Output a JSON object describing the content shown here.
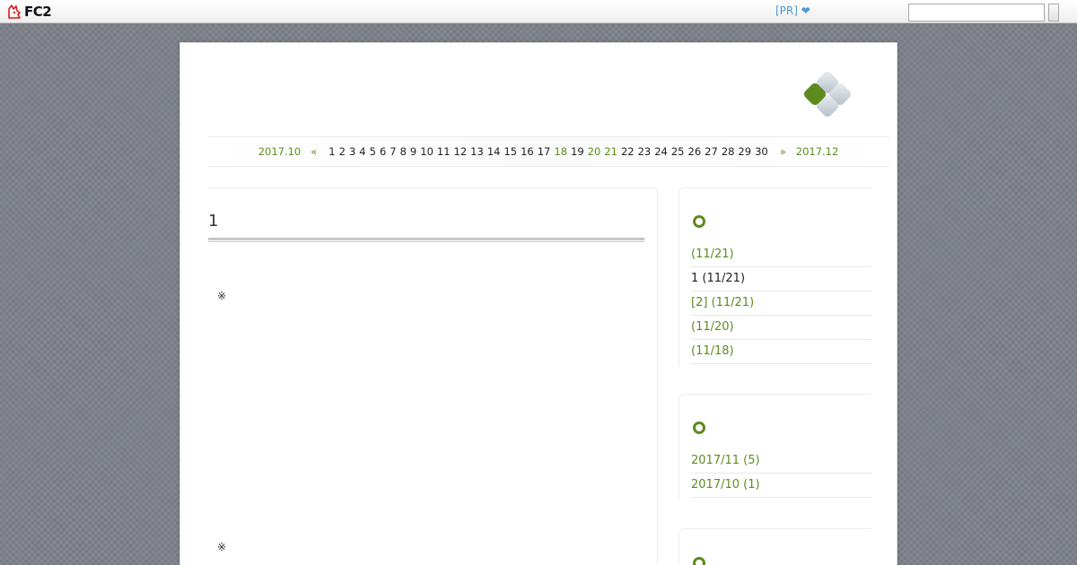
{
  "topbar": {
    "logo_text": "FC2",
    "pr_text": "[PR] ❤",
    "search": {
      "value": "",
      "placeholder": ""
    }
  },
  "calendar": {
    "prev_month": "2017.10",
    "prev_arrow": "«",
    "next_arrow": "»",
    "next_month": "2017.12",
    "days": [
      {
        "d": "1",
        "link": false
      },
      {
        "d": "2",
        "link": false
      },
      {
        "d": "3",
        "link": false
      },
      {
        "d": "4",
        "link": false
      },
      {
        "d": "5",
        "link": false
      },
      {
        "d": "6",
        "link": false
      },
      {
        "d": "7",
        "link": false
      },
      {
        "d": "8",
        "link": false
      },
      {
        "d": "9",
        "link": false
      },
      {
        "d": "10",
        "link": false
      },
      {
        "d": "11",
        "link": false
      },
      {
        "d": "12",
        "link": false
      },
      {
        "d": "13",
        "link": false
      },
      {
        "d": "14",
        "link": false
      },
      {
        "d": "15",
        "link": false
      },
      {
        "d": "16",
        "link": false
      },
      {
        "d": "17",
        "link": false
      },
      {
        "d": "18",
        "link": true
      },
      {
        "d": "19",
        "link": false
      },
      {
        "d": "20",
        "link": true
      },
      {
        "d": "21",
        "link": true
      },
      {
        "d": "22",
        "link": false
      },
      {
        "d": "23",
        "link": false
      },
      {
        "d": "24",
        "link": false
      },
      {
        "d": "25",
        "link": false
      },
      {
        "d": "26",
        "link": false
      },
      {
        "d": "27",
        "link": false
      },
      {
        "d": "28",
        "link": false
      },
      {
        "d": "29",
        "link": false
      },
      {
        "d": "30",
        "link": false
      }
    ]
  },
  "entry": {
    "title": "1",
    "markers": [
      "※",
      "※"
    ]
  },
  "sidebar": {
    "recent_entries": [
      {
        "label": " (11/21)",
        "current": false
      },
      {
        "label": "1 (11/21)",
        "current": true
      },
      {
        "label": "[2] (11/21)",
        "current": false
      },
      {
        "label": " (11/20)",
        "current": false
      },
      {
        "label": " (11/18)",
        "current": false
      }
    ],
    "archives": [
      {
        "label": "2017/11 (5)"
      },
      {
        "label": "2017/10 (1)"
      }
    ]
  },
  "colors": {
    "accent_green": "#5e8b1e",
    "pr_blue": "#4d98d0",
    "background": "#7d8189"
  }
}
